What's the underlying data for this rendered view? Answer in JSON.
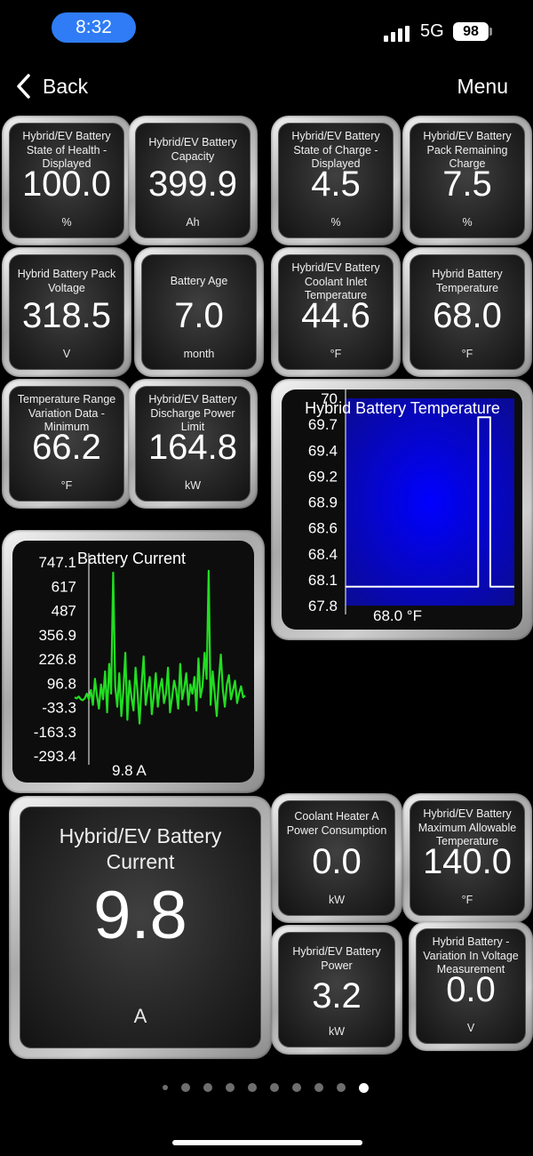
{
  "status_bar": {
    "time": "8:32",
    "network": "5G",
    "battery": "98"
  },
  "nav": {
    "back_label": "Back",
    "menu_label": "Menu"
  },
  "gauges": [
    {
      "title": "Hybrid/EV Battery State of Health - Displayed",
      "value": "100.0",
      "unit": "%"
    },
    {
      "title": "Hybrid/EV Battery Capacity",
      "value": "399.9",
      "unit": "Ah"
    },
    {
      "title": "Hybrid/EV Battery State of Charge - Displayed",
      "value": "4.5",
      "unit": "%"
    },
    {
      "title": "Hybrid/EV Battery Pack Remaining Charge",
      "value": "7.5",
      "unit": "%"
    },
    {
      "title": "Hybrid Battery Pack Voltage",
      "value": "318.5",
      "unit": "V"
    },
    {
      "title": "Battery Age",
      "value": "7.0",
      "unit": "month"
    },
    {
      "title": "Hybrid/EV Battery Coolant Inlet Temperature",
      "value": "44.6",
      "unit": "°F"
    },
    {
      "title": "Hybrid Battery Temperature",
      "value": "68.0",
      "unit": "°F"
    },
    {
      "title": "Temperature Range Variation Data - Minimum",
      "value": "66.2",
      "unit": "°F"
    },
    {
      "title": "Hybrid/EV Battery Discharge Power Limit",
      "value": "164.8",
      "unit": "kW"
    },
    {
      "title": "Hybrid/EV Battery Current",
      "value": "9.8",
      "unit": "A"
    },
    {
      "title": "Coolant Heater A Power Consumption",
      "value": "0.0",
      "unit": "kW"
    },
    {
      "title": "Hybrid/EV Battery Maximum Allowable Temperature",
      "value": "140.0",
      "unit": "°F"
    },
    {
      "title": "Hybrid/EV Battery Power",
      "value": "3.2",
      "unit": "kW"
    },
    {
      "title": "Hybrid Battery - Variation In Voltage Measurement",
      "value": "0.0",
      "unit": "V"
    }
  ],
  "chart_data": [
    {
      "type": "line",
      "title": "Hybrid Battery Temperature",
      "readout": "68.0 °F",
      "ytick_labels": [
        "70",
        "69.7",
        "69.4",
        "69.2",
        "68.9",
        "68.6",
        "68.4",
        "68.1",
        "67.8"
      ],
      "ylim": [
        67.8,
        70
      ],
      "line_color": "#ffffff",
      "background_color": "#0a0a9a",
      "series": [
        {
          "x": [
            0,
            55,
            55,
            60,
            60,
            70
          ],
          "y": [
            68.0,
            68.0,
            69.8,
            69.8,
            68.0,
            68.0
          ]
        }
      ]
    },
    {
      "type": "line",
      "title": "Battery Current",
      "readout": "9.8 A",
      "ytick_labels": [
        "747.1",
        "617",
        "487",
        "356.9",
        "226.8",
        "96.8",
        "-33.3",
        "-163.3",
        "-293.4"
      ],
      "ylim": [
        -293.4,
        747.1
      ],
      "line_color": "#22dd22",
      "series": [
        {
          "x": [
            0,
            1,
            2,
            3,
            4,
            5,
            6,
            7,
            8,
            9,
            10,
            11,
            12,
            13,
            14,
            15,
            16,
            17,
            18,
            19,
            20,
            21,
            22,
            23,
            24,
            25,
            26,
            27,
            28,
            29,
            30,
            31,
            32,
            33,
            34,
            35,
            36,
            37,
            38,
            39,
            40,
            41,
            42,
            43,
            44,
            45,
            46,
            47,
            48,
            49,
            50,
            51,
            52,
            53,
            54,
            55,
            56,
            57,
            58,
            59,
            60,
            61,
            62,
            63,
            64,
            65,
            66,
            67,
            68,
            69,
            70,
            71,
            72,
            73,
            74,
            75,
            76,
            77,
            78,
            79,
            80,
            81,
            82,
            83,
            84
          ],
          "y": [
            20,
            15,
            25,
            10,
            5,
            15,
            40,
            10,
            60,
            -20,
            120,
            30,
            -40,
            90,
            10,
            160,
            -60,
            200,
            40,
            690,
            80,
            -30,
            150,
            -80,
            60,
            260,
            -100,
            110,
            20,
            -50,
            180,
            40,
            -120,
            90,
            240,
            -20,
            60,
            130,
            -70,
            30,
            150,
            -30,
            70,
            120,
            -10,
            40,
            180,
            -60,
            20,
            110,
            60,
            -40,
            200,
            10,
            70,
            150,
            -20,
            90,
            40,
            130,
            -50,
            230,
            20,
            80,
            260,
            120,
            700,
            -20,
            160,
            40,
            -80,
            110,
            250,
            60,
            -30,
            90,
            140,
            10,
            60,
            110,
            -10,
            40,
            80,
            20,
            30
          ]
        }
      ]
    }
  ],
  "pager": {
    "count": 10,
    "active": 9
  }
}
